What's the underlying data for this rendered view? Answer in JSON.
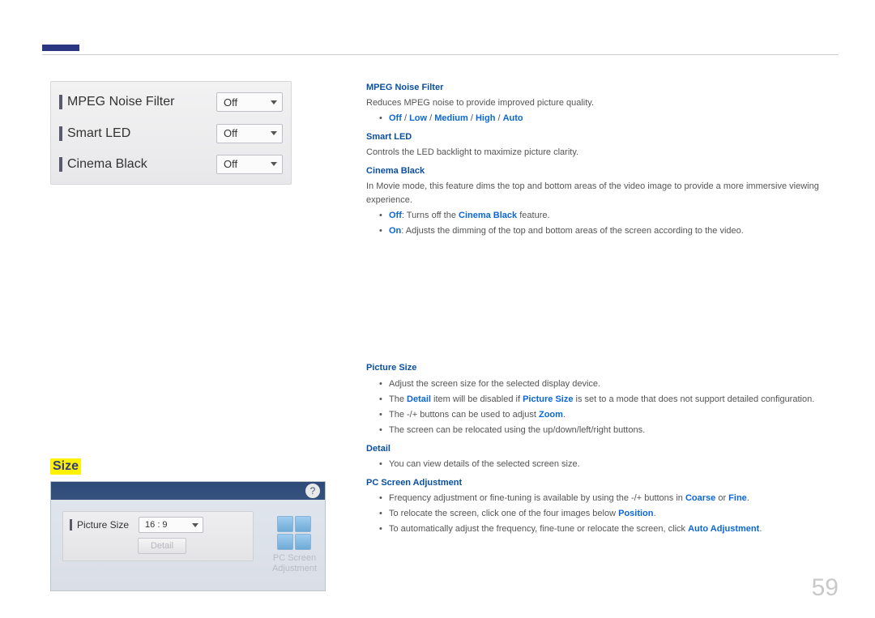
{
  "panel1": {
    "rows": [
      {
        "label": "MPEG Noise Filter",
        "value": "Off"
      },
      {
        "label": "Smart LED",
        "value": "Off"
      },
      {
        "label": "Cinema Black",
        "value": "Off"
      }
    ]
  },
  "sectionHeader": "Size",
  "panel2": {
    "help": "?",
    "label": "Picture Size",
    "value": "16 : 9",
    "detailBtn": "Detail",
    "pcAdjLine1": "PC Screen",
    "pcAdjLine2": "Adjustment"
  },
  "content": {
    "mpeg": {
      "title": "MPEG Noise Filter",
      "desc": "Reduces MPEG noise to provide improved picture quality.",
      "opts": {
        "off": "Off",
        "low": "Low",
        "medium": "Medium",
        "high": "High",
        "auto": "Auto",
        "sep": " / "
      }
    },
    "smartled": {
      "title": "Smart LED",
      "desc": "Controls the LED backlight to maximize picture clarity."
    },
    "cinema": {
      "title": "Cinema Black",
      "desc": "In Movie mode, this feature dims the top and bottom areas of the video image to provide a more immersive viewing experience.",
      "offLabel": "Off",
      "offText": ": Turns off the ",
      "offRef": "Cinema Black",
      "offText2": " feature.",
      "onLabel": "On",
      "onText": ": Adjusts the dimming of the top and bottom areas of the screen according to the video."
    },
    "ps": {
      "title": "Picture Size",
      "b1": "Adjust the screen size for the selected display device.",
      "b2a": "The ",
      "b2b": "Detail",
      "b2c": " item will be disabled if ",
      "b2d": "Picture Size",
      "b2e": " is set to a mode that does not support detailed configuration.",
      "b3a": "The -/+ buttons can be used to adjust ",
      "b3b": "Zoom",
      "b3c": ".",
      "b4": "The screen can be relocated using the up/down/left/right buttons."
    },
    "detail": {
      "title": "Detail",
      "b1": "You can view details of the selected screen size."
    },
    "pcadj": {
      "title": "PC Screen Adjustment",
      "b1a": "Frequency adjustment or fine-tuning is available by using the -/+ buttons in ",
      "b1b": "Coarse",
      "b1c": " or ",
      "b1d": "Fine",
      "b1e": ".",
      "b2a": "To relocate the screen, click one of the four images below ",
      "b2b": "Position",
      "b2c": ".",
      "b3a": "To automatically adjust the frequency, fine-tune or relocate the screen, click ",
      "b3b": "Auto Adjustment",
      "b3c": "."
    }
  },
  "pageNumber": "59"
}
